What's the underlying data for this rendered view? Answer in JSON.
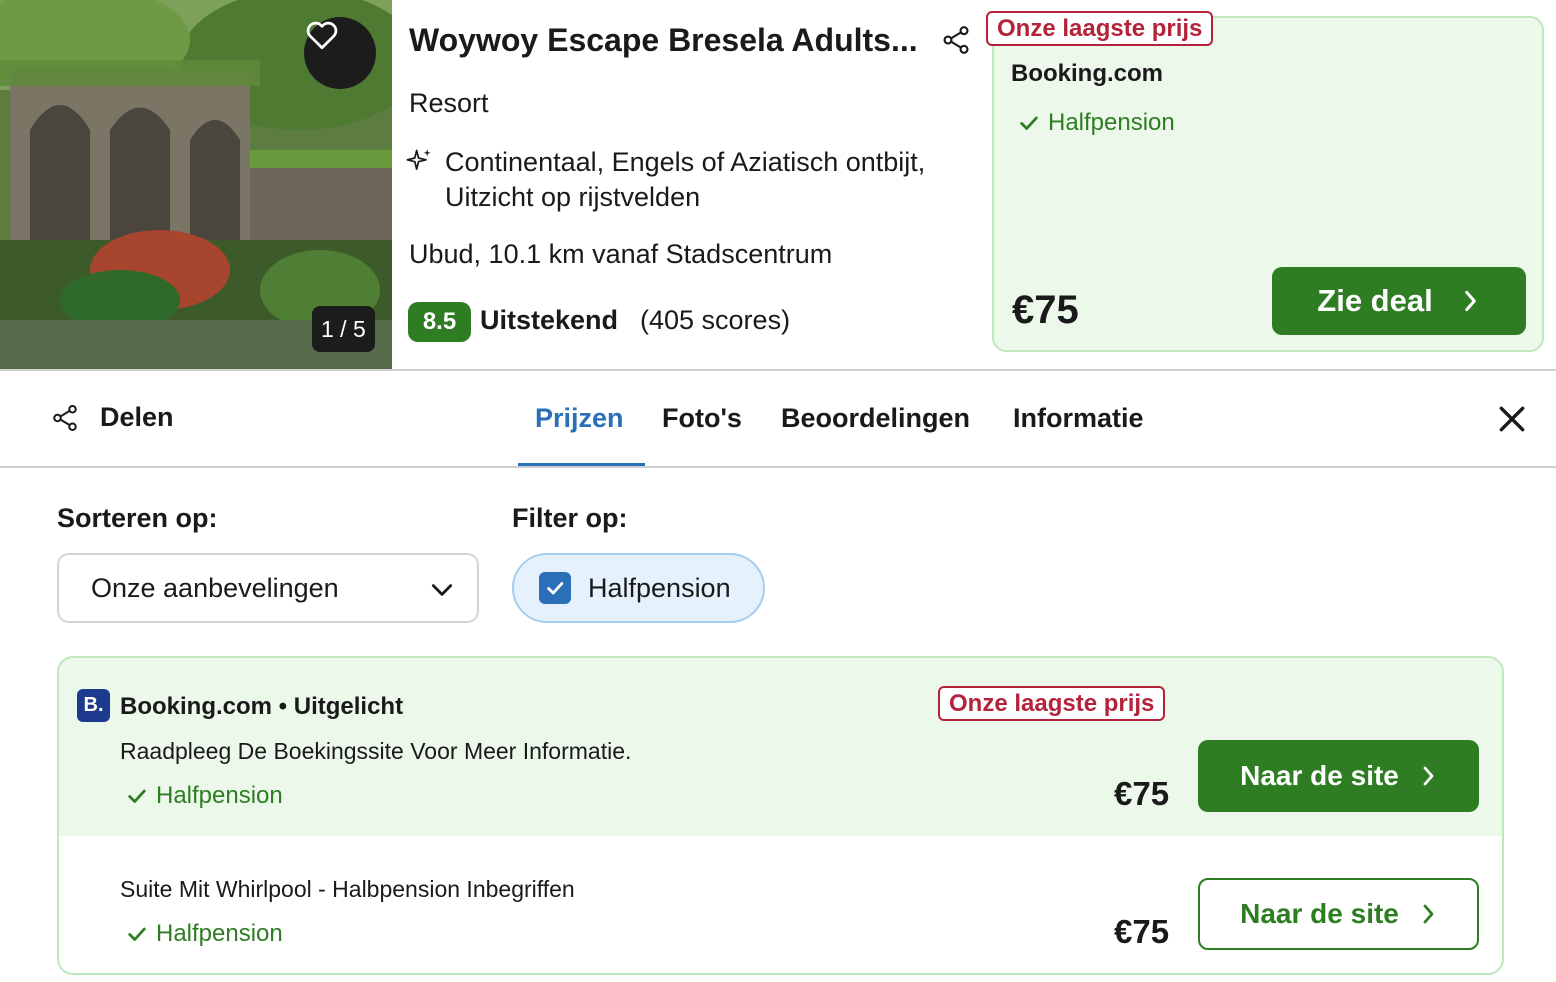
{
  "hotel": {
    "title": "Woywoy Escape Bresela Adults...",
    "type": "Resort",
    "amenities": "Continentaal, Engels of Aziatisch ontbijt, Uitzicht op rijstvelden",
    "location": "Ubud, 10.1 km vanaf Stadscentrum",
    "photo_counter": "1 / 5",
    "rating": {
      "score": "8.5",
      "label": "Uitstekend",
      "count": "(405 scores)"
    }
  },
  "top_deal": {
    "badge": "Onze laagste prijs",
    "provider": "Booking.com",
    "feature": "Halfpension",
    "price": "€75",
    "button_label": "Zie deal"
  },
  "tabbar": {
    "share_label": "Delen",
    "tabs": [
      {
        "label": "Prijzen",
        "active": true
      },
      {
        "label": "Foto's",
        "active": false
      },
      {
        "label": "Beoordelingen",
        "active": false
      },
      {
        "label": "Informatie",
        "active": false
      }
    ]
  },
  "controls": {
    "sort_label": "Sorteren op:",
    "sort_value": "Onze aanbevelingen",
    "filter_label": "Filter op:",
    "filter_chip": "Halfpension",
    "filter_checked": true
  },
  "offers": [
    {
      "provider": "Booking.com • Uitgelicht",
      "provider_logo": "B.",
      "badge": "Onze laagste prijs",
      "description": "Raadpleeg De Boekingssite Voor Meer Informatie.",
      "feature": "Halfpension",
      "price": "€75",
      "button_label": "Naar de site"
    },
    {
      "description": "Suite Mit Whirlpool - Halbpension Inbegriffen",
      "feature": "Halfpension",
      "price": "€75",
      "button_label": "Naar de site"
    }
  ],
  "colors": {
    "green": "#2e7d23",
    "green_light": "#ebf8ea",
    "red_badge": "#b3243a",
    "blue_accent": "#2b6fb8",
    "booking_blue": "#1d3a8f"
  },
  "icons": [
    "heart-icon",
    "share-icon",
    "sparkle-icon",
    "check-icon",
    "chevron-right-icon",
    "chevron-down-icon",
    "close-icon",
    "checkbox-checked-icon"
  ]
}
